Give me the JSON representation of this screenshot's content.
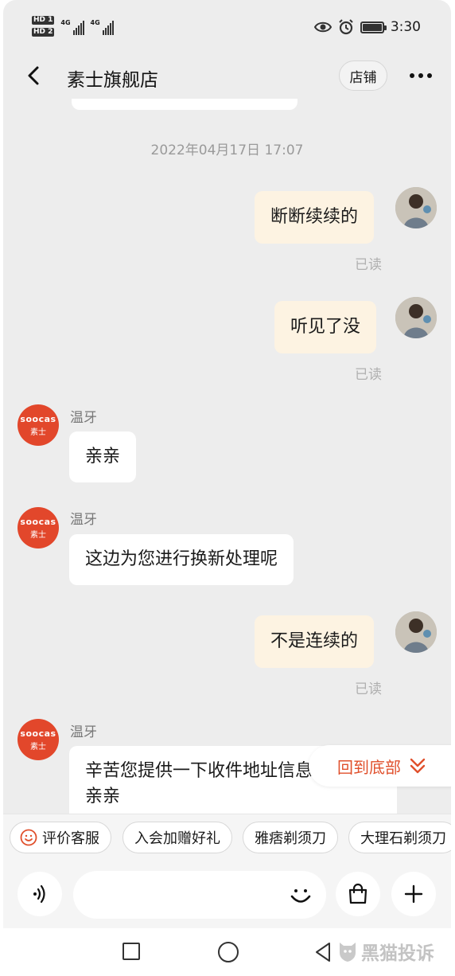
{
  "status_bar": {
    "sim1": "HD 1",
    "sim2": "HD 2",
    "net1": "4G",
    "net2": "4G",
    "time": "3:30",
    "icons": [
      "eye-icon",
      "alarm-icon",
      "battery-icon"
    ]
  },
  "header": {
    "title": "素士旗舰店",
    "shop_button": "店铺"
  },
  "chat": {
    "timestamp": "2022年04月17日 17:07",
    "messages": [
      {
        "side": "out",
        "text": "断断续续的",
        "status": "已读"
      },
      {
        "side": "out",
        "text": "听见了没",
        "status": "已读"
      },
      {
        "side": "in",
        "sender": "温牙",
        "text": "亲亲",
        "avatar_brand": "soocas",
        "avatar_cn": "素士"
      },
      {
        "side": "in",
        "sender": "温牙",
        "text": "这边为您进行换新处理呢",
        "avatar_brand": "soocas",
        "avatar_cn": "素士"
      },
      {
        "side": "out",
        "text": "不是连续的",
        "status": "已读"
      },
      {
        "side": "in",
        "sender": "温牙",
        "text_line1": "辛苦您提供一下收件地址信息呢",
        "text_line2": "亲亲",
        "avatar_brand": "soocas",
        "avatar_cn": "素士"
      }
    ],
    "scroll_to_bottom": "回到底部"
  },
  "quick_replies": [
    "评价客服",
    "入会加赠好礼",
    "雅痞剃须刀",
    "大理石剃须刀"
  ],
  "input": {
    "placeholder": ""
  },
  "watermark": "黑猫投诉",
  "colors": {
    "background": "#ededed",
    "outgoing_bubble": "#fdf3e2",
    "incoming_bubble": "#ffffff",
    "accent": "#e0502c",
    "shop_avatar": "#e2472b"
  }
}
